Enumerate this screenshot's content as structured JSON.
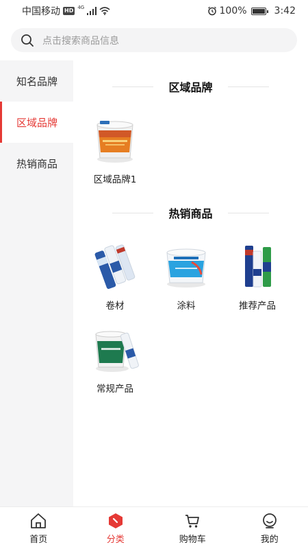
{
  "status_bar": {
    "carrier": "中国移动",
    "hd_badge": "HD",
    "network": "4G",
    "battery": "100%",
    "time": "3:42"
  },
  "search": {
    "placeholder": "点击搜索商品信息",
    "icon": "search-icon"
  },
  "sidebar": {
    "items": [
      {
        "label": "知名品牌",
        "active": false
      },
      {
        "label": "区域品牌",
        "active": true
      },
      {
        "label": "热销商品",
        "active": false
      }
    ]
  },
  "main": {
    "sections": [
      {
        "title": "区域品牌",
        "products": [
          {
            "name": "区域品牌1",
            "icon": "orange-paint-bucket-icon"
          }
        ]
      },
      {
        "title": "热销商品",
        "products": [
          {
            "name": "卷材",
            "icon": "membrane-rolls-icon"
          },
          {
            "name": "涂料",
            "icon": "blue-paint-bucket-icon"
          },
          {
            "name": "推荐产品",
            "icon": "tube-packs-icon"
          },
          {
            "name": "常规产品",
            "icon": "green-bucket-roll-icon"
          }
        ]
      }
    ]
  },
  "tab_bar": {
    "items": [
      {
        "label": "首页",
        "icon": "home-icon",
        "active": false
      },
      {
        "label": "分类",
        "icon": "category-icon",
        "active": true
      },
      {
        "label": "购物车",
        "icon": "cart-icon",
        "active": false
      },
      {
        "label": "我的",
        "icon": "profile-icon",
        "active": false
      }
    ]
  },
  "colors": {
    "accent": "#e53935",
    "sidebar_bg": "#f5f5f6",
    "search_bg": "#f4f4f5"
  }
}
